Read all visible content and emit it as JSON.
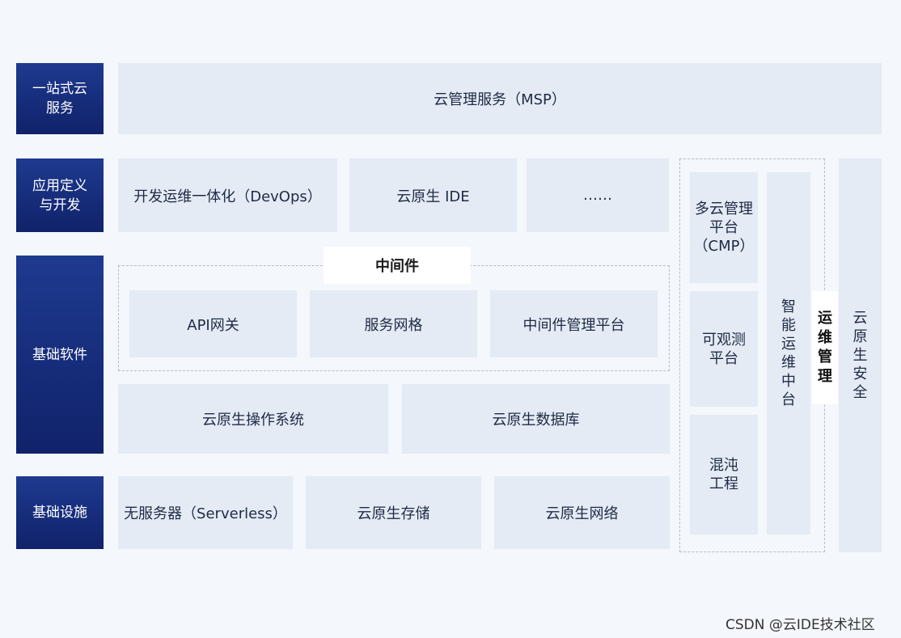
{
  "layers": {
    "one_stop": "一站式云\n服务",
    "app_dev": "应用定义\n与开发",
    "base_software": "基础软件",
    "infrastructure": "基础设施"
  },
  "msp": "云管理服务（MSP）",
  "app_dev_items": [
    "开发运维一体化（DevOps）",
    "云原生 IDE",
    "……"
  ],
  "middleware": {
    "label": "中间件",
    "items": [
      "API网关",
      "服务网格",
      "中间件管理平台"
    ]
  },
  "base_software_items": [
    "云原生操作系统",
    "云原生数据库"
  ],
  "infra_items": [
    "无服务器（Serverless）",
    "云原生存储",
    "云原生网络"
  ],
  "ops": {
    "label": "运\n维\n管\n理",
    "multi_cloud": "多云管理\n平台\n（CMP）",
    "observability": "可观测\n平台",
    "chaos": "混沌\n工程",
    "aiops": "智\n能\n运\n维\n中\n台"
  },
  "security": "云\n原\n生\n安\n全",
  "watermark": "CSDN @云IDE技术社区"
}
